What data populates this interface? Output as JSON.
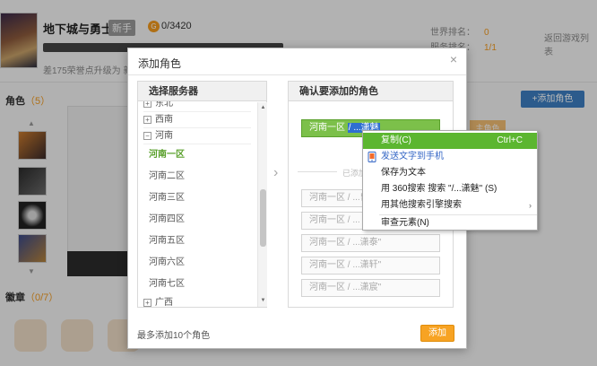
{
  "background": {
    "game_title": "地下城与勇士",
    "level_badge": "新手",
    "coin_symbol": "G",
    "coins": "0/3420",
    "progress_text": "差175荣誉点升级为 新手",
    "world_rank_label": "世界排名：",
    "world_rank_value": "0",
    "server_rank_label": "服务排名：",
    "server_rank_value": "1/1",
    "back_to_list": "返回游戏列表",
    "roles_label": "角色",
    "roles_count": "（5）",
    "add_role_button": "+添加角色",
    "badges_label": "徽章",
    "badges_count": "（0/7）",
    "up_arrow": "▲",
    "down_arrow": "▼",
    "bg_orange_button": "主角色"
  },
  "modal": {
    "title": "添加角色",
    "close_icon": "×",
    "left_panel_title": "选择服务器",
    "right_panel_title": "确认要添加的角色",
    "server_groups": [
      {
        "label": "东北",
        "expanded": false
      },
      {
        "label": "西南",
        "expanded": false
      },
      {
        "label": "河南",
        "expanded": true
      }
    ],
    "servers": [
      "河南一区",
      "河南二区",
      "河南三区",
      "河南四区",
      "河南五区",
      "河南六区",
      "河南七区"
    ],
    "active_server": "河南一区",
    "next_group": "广西",
    "selected_role": {
      "prefix": "河南一区 ",
      "highlight": "/ ...潇魅"
    },
    "added_label": "已添加",
    "role_slots": [
      "河南一区 / ...曾",
      "河南一区 / ...",
      "河南一区 / ...潇泰\"",
      "河南一区 / ...潇轩\"",
      "河南一区 / ...潇宸\""
    ],
    "footer_note": "最多添加10个角色",
    "add_button": "添加"
  },
  "context_menu": {
    "items": [
      {
        "label": "复制(C)",
        "shortcut": "Ctrl+C",
        "selected": true
      },
      {
        "label": "发送文字到手机",
        "icon": "phone-icon"
      },
      {
        "label": "保存为文本"
      },
      {
        "label": "用 360搜索 搜索 \"/...潇魅\" (S)"
      },
      {
        "label": "用其他搜索引擎搜索",
        "submenu": true
      },
      {
        "label": "审查元素(N)"
      }
    ],
    "submenu_arrow": "›"
  },
  "colors": {
    "accent_green": "#5cb630",
    "orange": "#f7a323",
    "link_blue": "#3466c5",
    "selection_blue": "#2f6fd1"
  }
}
